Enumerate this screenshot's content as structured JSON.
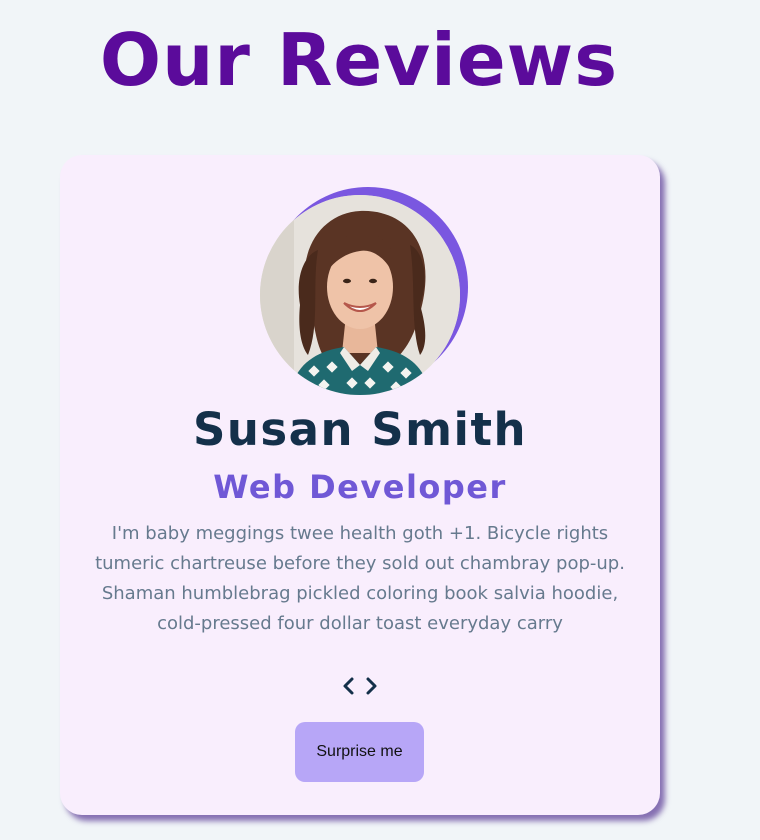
{
  "page": {
    "title": "Our Reviews"
  },
  "review": {
    "name": "Susan Smith",
    "job": "Web Developer",
    "text": "I'm baby meggings twee health goth +1. Bicycle rights tumeric chartreuse before they sold out chambray pop-up. Shaman humblebrag pickled coloring book salvia hoodie, cold-pressed four dollar toast everyday carry"
  },
  "controls": {
    "prev_icon": "chevron-left-icon",
    "next_icon": "chevron-right-icon",
    "random_label": "Surprise me"
  },
  "colors": {
    "title": "#5b0b9b",
    "name": "#14304a",
    "job": "#7058d6",
    "text": "#667a8e",
    "card_bg": "#f9eefd",
    "accent": "#7a57e0",
    "button_bg": "#b7a6f7",
    "page_bg": "#f1f5f8"
  }
}
